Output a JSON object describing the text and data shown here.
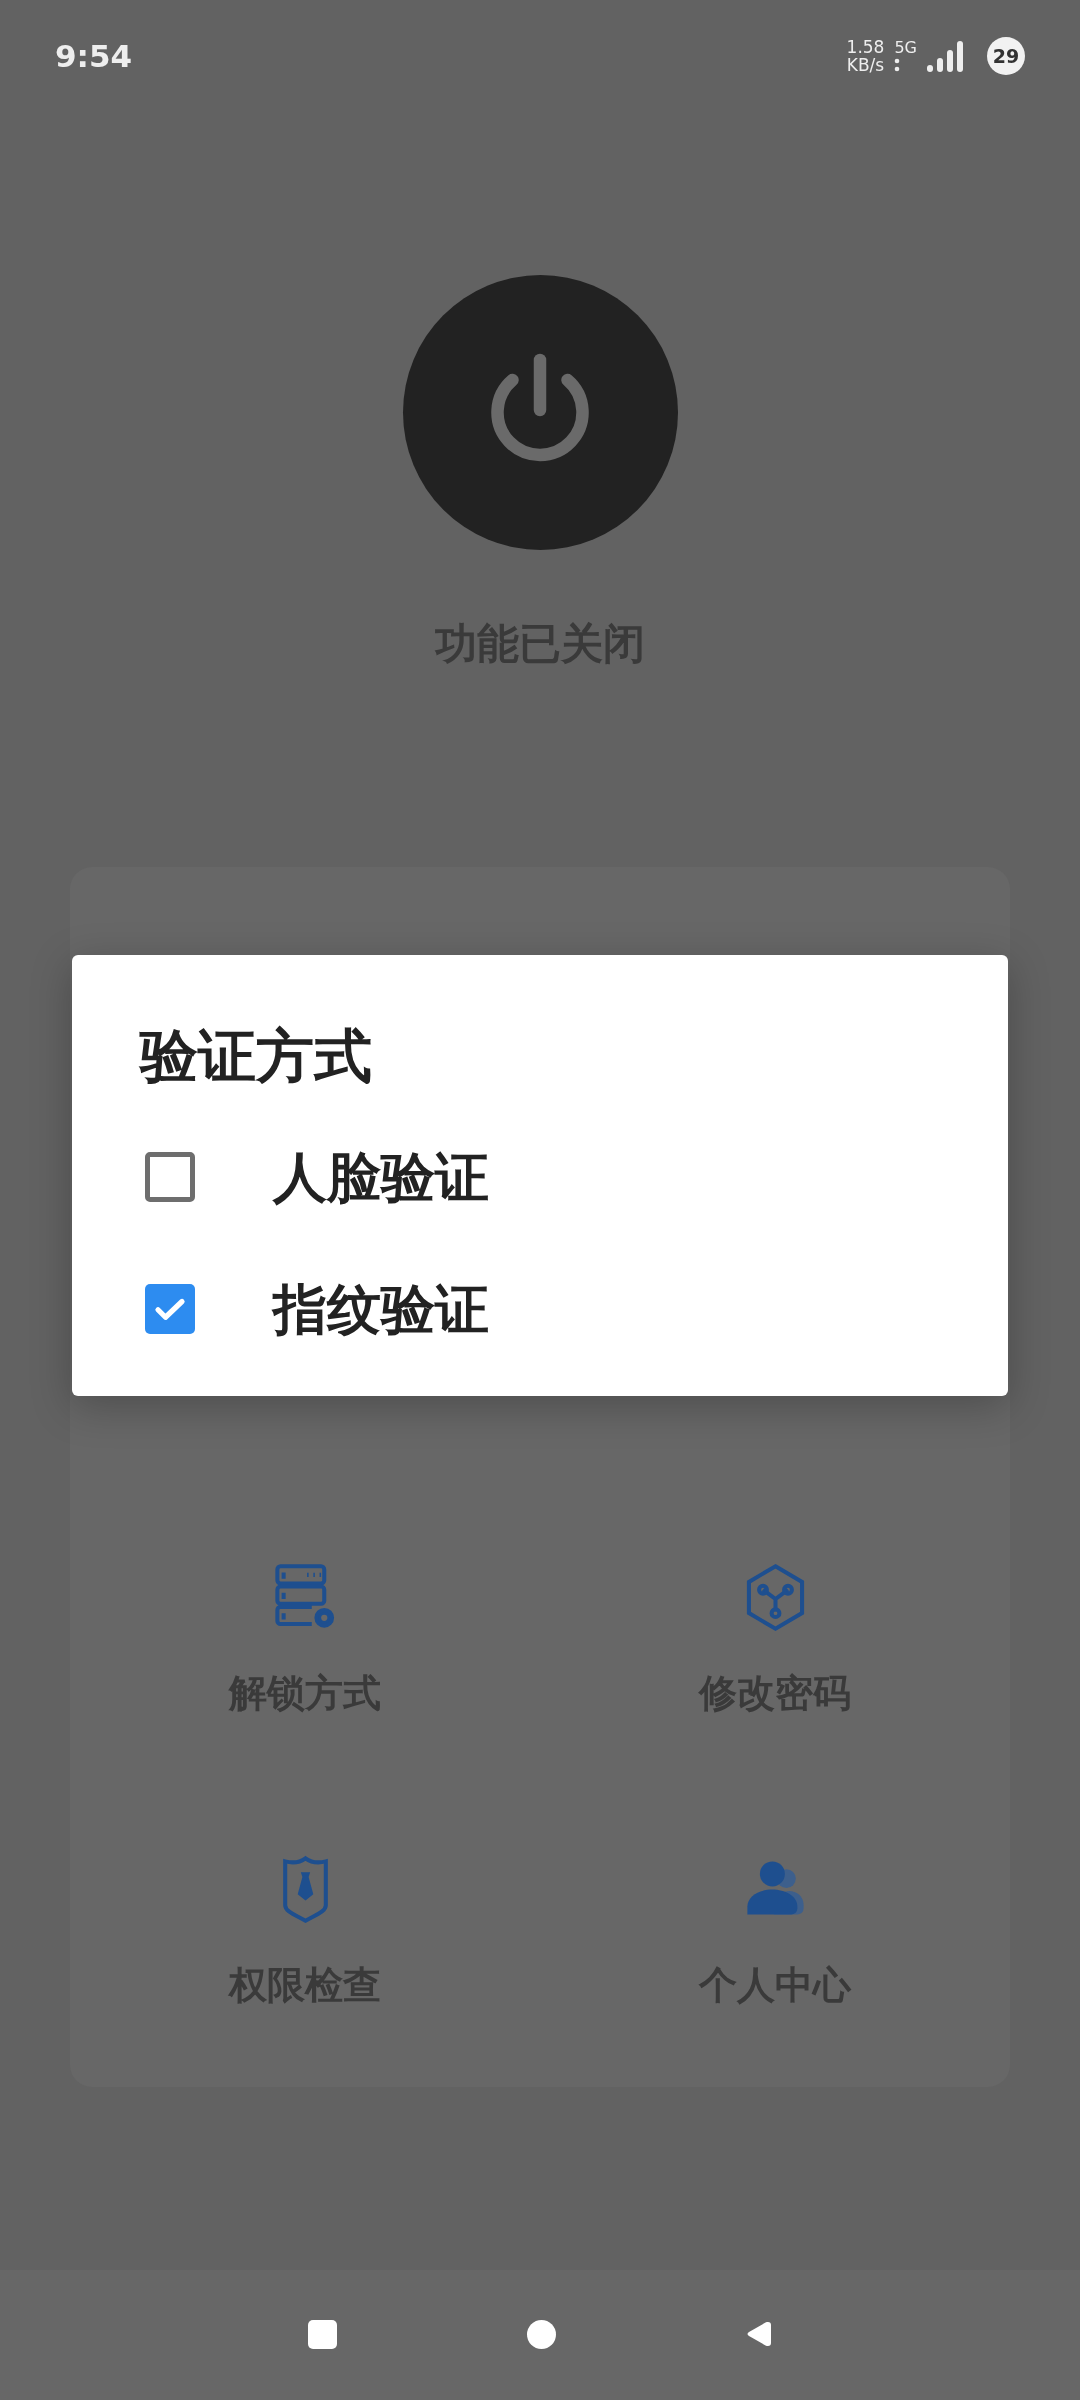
{
  "status_bar": {
    "time": "9:54",
    "speed_value": "1.58",
    "speed_unit": "KB/s",
    "network": "5G",
    "battery": "29"
  },
  "power": {
    "on": false,
    "status": "功能已关闭"
  },
  "menu": [
    {
      "label": "解锁方式"
    },
    {
      "label": "修改密码"
    },
    {
      "label": "权限检查"
    },
    {
      "label": "个人中心"
    }
  ],
  "dialog": {
    "title": "验证方式",
    "options": [
      {
        "label": "人脸验证",
        "checked": false
      },
      {
        "label": "指纹验证",
        "checked": true
      }
    ]
  }
}
